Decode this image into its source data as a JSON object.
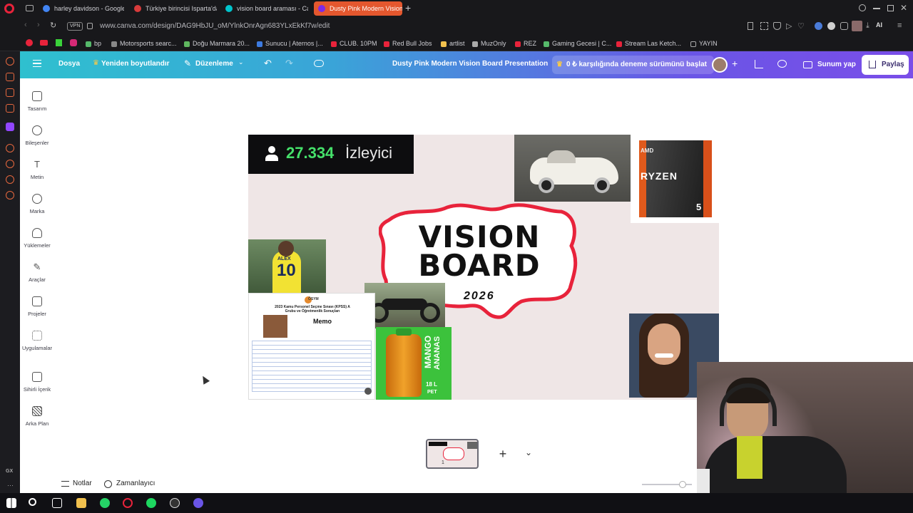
{
  "browser": {
    "tabs": [
      {
        "label": "harley davidson - Google'd",
        "color": "#4285f4"
      },
      {
        "label": "Türkiye birincisi Isparta'da",
        "color": "#d83b3b"
      },
      {
        "label": "vision board araması - Ca",
        "color": "#00c4cc"
      },
      {
        "label": "Dusty Pink Modern Vision",
        "color": "#7d2ae8"
      }
    ],
    "url": "www.canva.com/design/DAG9HbJU_oM/YlnkOnrAgn683YLxEkKf7w/edit",
    "vpn_label": "VPN",
    "ai_label": "AI",
    "bookmarks": [
      "bp",
      "Motorsports searc...",
      "Doğu Marmara 20...",
      "Sunucu | Aternos |...",
      "CLUB. 10PM",
      "Red Bull Jobs",
      "artlist",
      "MuzOnly",
      "REZ",
      "Gaming Gecesi | C...",
      "Stream Las Ketch...",
      "YAYIN"
    ]
  },
  "canva_header": {
    "file_label": "Dosya",
    "resize_label": "Yeniden boyutlandır",
    "edit_label": "Düzenleme",
    "design_title": "Dusty Pink Modern Vision Board Presentation",
    "trial_label": "0 ₺ karşılığında deneme sürümünü başlat",
    "present_label": "Sunum yap",
    "share_label": "Paylaş"
  },
  "sidebar": {
    "items": [
      {
        "label": "Tasarım",
        "icon": "layout-icon"
      },
      {
        "label": "Bileşenler",
        "icon": "elements-icon"
      },
      {
        "label": "Metin",
        "icon": "text-icon"
      },
      {
        "label": "Marka",
        "icon": "brand-icon"
      },
      {
        "label": "Yüklemeler",
        "icon": "upload-icon"
      },
      {
        "label": "Araçlar",
        "icon": "draw-icon"
      },
      {
        "label": "Projeler",
        "icon": "folder-icon"
      },
      {
        "label": "Uygulamalar",
        "icon": "apps-icon"
      },
      {
        "label": "Sihirli İçerik",
        "icon": "magic-media-icon"
      },
      {
        "label": "Arka Plan",
        "icon": "background-icon"
      }
    ]
  },
  "slide": {
    "viewer_count": "27.334",
    "viewer_label": "İzleyici",
    "title_line1": "VISION",
    "title_line2": "BOARD",
    "year": "2026",
    "jersey_name": "ALEX",
    "jersey_number": "10",
    "ryzen_brand": "AMD",
    "ryzen_label": "RYZEN",
    "ryzen_tier": "5",
    "doc_header": "ÖSYM",
    "doc_title": "2023 Kamu Personel Seçme Sınavı (KPSS) A Grubu ve Öğretmenlik Sonuçları",
    "memo_label": "Memo",
    "juice_label_1": "MANGO",
    "juice_label_2": "ANANAS",
    "juice_volume": "18 L",
    "juice_pet": "PET"
  },
  "bottom_bar": {
    "notes_label": "Notlar",
    "timer_label": "Zamanlayıcı",
    "page_number": "1"
  },
  "colors": {
    "accent_red": "#e8233b",
    "slide_bg": "#efe6e6",
    "juice_green": "#3cc23c"
  }
}
